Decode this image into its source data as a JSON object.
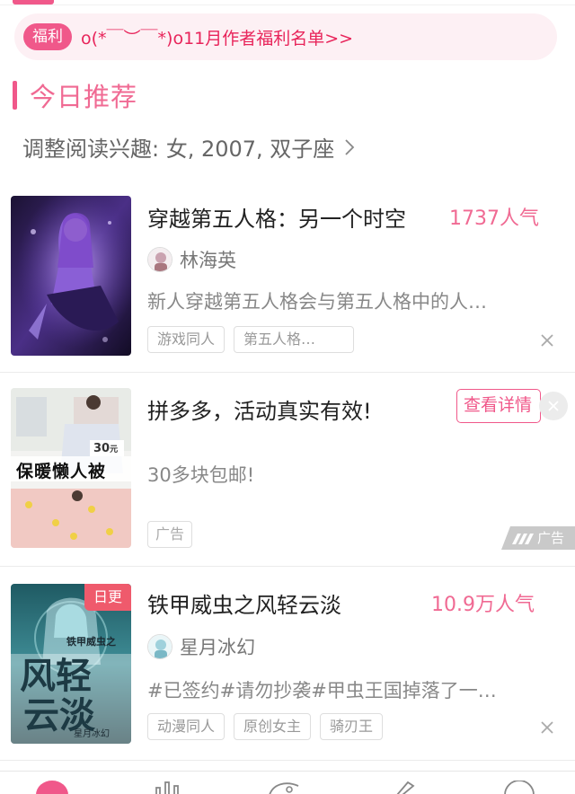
{
  "notice": {
    "badge": "福利",
    "text": "o(*￣︶￣*)o11月作者福利名单>>"
  },
  "section": {
    "title": "今日推荐"
  },
  "preference": {
    "text": "调整阅读兴趣: 女, 2007, 双子座"
  },
  "books": [
    {
      "title": "穿越第五人格：另一个时空",
      "popularity": "1737人气",
      "author": "林海英",
      "description": "新人穿越第五人格会与第五人格中的人…",
      "tags": [
        "游戏同人",
        "第五人格…"
      ]
    },
    {
      "title": "铁甲威虫之风轻云淡",
      "popularity": "10.9万人气",
      "author": "星月冰幻",
      "description": "#已签约#请勿抄袭#甲虫王国掉落了一…",
      "tags": [
        "动漫同人",
        "原创女主",
        "骑刃王"
      ],
      "badge": "日更",
      "cover_text": {
        "line1": "风轻",
        "line2": "云淡",
        "series": "铁甲威虫之",
        "author": "星月冰幻"
      }
    }
  ],
  "ad": {
    "title": "拼多多，活动真实有效!",
    "subtitle": "30多块包邮!",
    "cta": "查看详情",
    "tag": "广告",
    "label": "广告",
    "image_text": "保暖懒人被",
    "image_price": "30",
    "image_price_unit": "元"
  },
  "colors": {
    "accent": "#f0588a",
    "notice_bg": "#fdf0f4",
    "badge_red": "#ef5a6c"
  },
  "icons": [
    "chevron-right-icon",
    "close-icon",
    "ad-mark-icon",
    "tab-home-icon",
    "tab-rank-icon",
    "tab-discover-icon",
    "tab-write-icon",
    "tab-profile-icon"
  ]
}
